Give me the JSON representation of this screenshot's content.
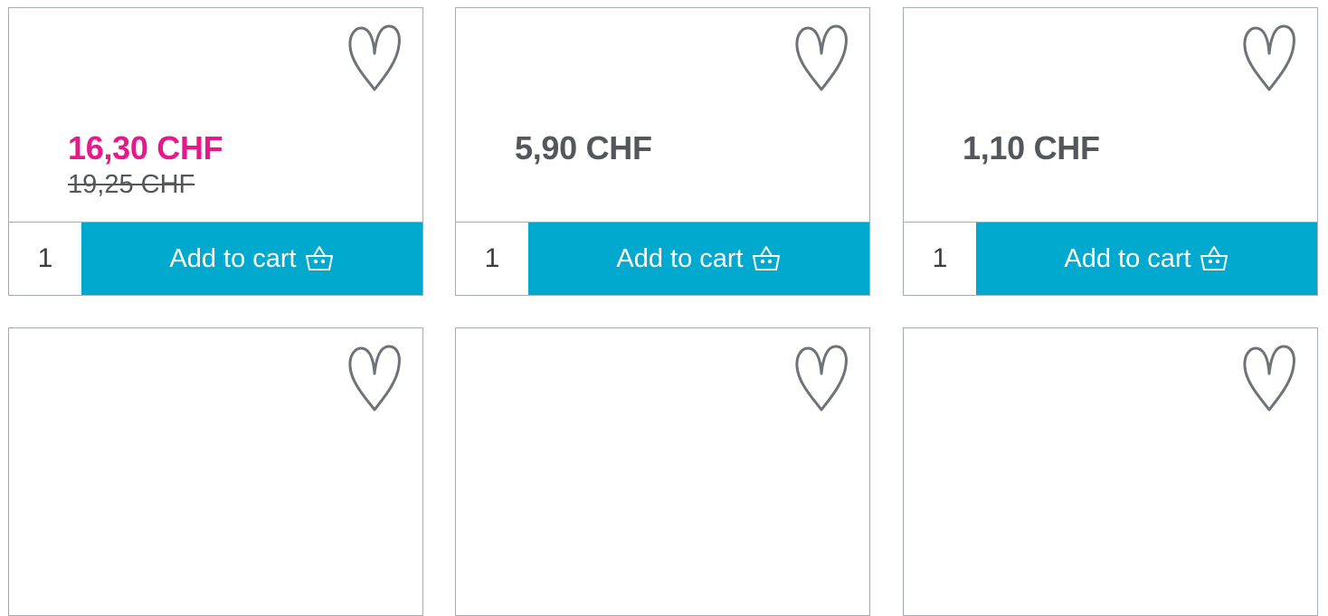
{
  "colors": {
    "accent": "#00a9cd",
    "sale": "#e5198a",
    "text": "#53575b",
    "border": "#a5acb2"
  },
  "icons": {
    "wishlist": "heart-icon",
    "cart": "basket-icon"
  },
  "products": [
    {
      "price": "16,30 CHF",
      "old_price": "19,25 CHF",
      "quantity": "1",
      "button_label": "Add to cart"
    },
    {
      "price": "5,90 CHF",
      "quantity": "1",
      "button_label": "Add to cart"
    },
    {
      "price": "1,10 CHF",
      "quantity": "1",
      "button_label": "Add to cart"
    },
    {
      "price": ""
    },
    {
      "price": ""
    },
    {
      "price": ""
    }
  ]
}
